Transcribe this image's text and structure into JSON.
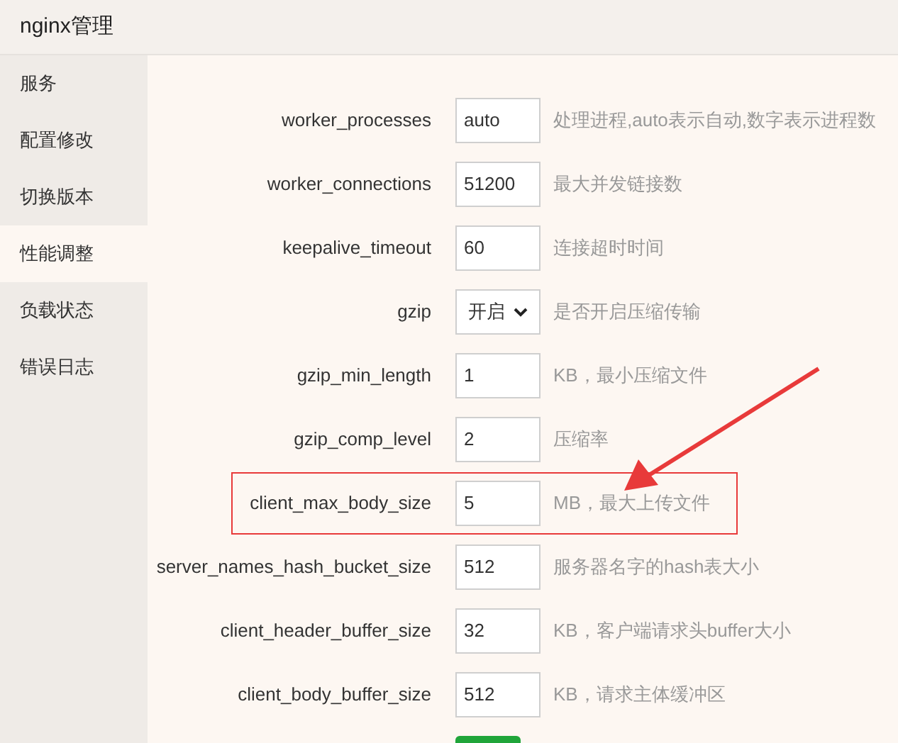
{
  "window": {
    "title": "nginx管理"
  },
  "sidebar": {
    "items": [
      {
        "label": "服务",
        "selected": false
      },
      {
        "label": "配置修改",
        "selected": false
      },
      {
        "label": "切换版本",
        "selected": false
      },
      {
        "label": "性能调整",
        "selected": true
      },
      {
        "label": "负载状态",
        "selected": false
      },
      {
        "label": "错误日志",
        "selected": false
      }
    ]
  },
  "settings": [
    {
      "kind": "input",
      "name": "worker_processes",
      "value": "auto",
      "hint": "处理进程,auto表示自动,数字表示进程数",
      "highlighted": false
    },
    {
      "kind": "input",
      "name": "worker_connections",
      "value": "51200",
      "hint": "最大并发链接数",
      "highlighted": false
    },
    {
      "kind": "input",
      "name": "keepalive_timeout",
      "value": "60",
      "hint": "连接超时时间",
      "highlighted": false
    },
    {
      "kind": "select",
      "name": "gzip",
      "value": "开启",
      "hint": "是否开启压缩传输",
      "highlighted": false
    },
    {
      "kind": "input",
      "name": "gzip_min_length",
      "value": "1",
      "hint": "KB，最小压缩文件",
      "highlighted": false
    },
    {
      "kind": "input",
      "name": "gzip_comp_level",
      "value": "2",
      "hint": "压缩率",
      "highlighted": false
    },
    {
      "kind": "input",
      "name": "client_max_body_size",
      "value": "5",
      "hint": "MB，最大上传文件",
      "highlighted": true
    },
    {
      "kind": "input",
      "name": "server_names_hash_bucket_size",
      "value": "512",
      "hint": "服务器名字的hash表大小",
      "highlighted": false
    },
    {
      "kind": "input",
      "name": "client_header_buffer_size",
      "value": "32",
      "hint": "KB，客户端请求头buffer大小",
      "highlighted": false
    },
    {
      "kind": "input",
      "name": "client_body_buffer_size",
      "value": "512",
      "hint": "KB，请求主体缓冲区",
      "highlighted": false
    }
  ]
}
